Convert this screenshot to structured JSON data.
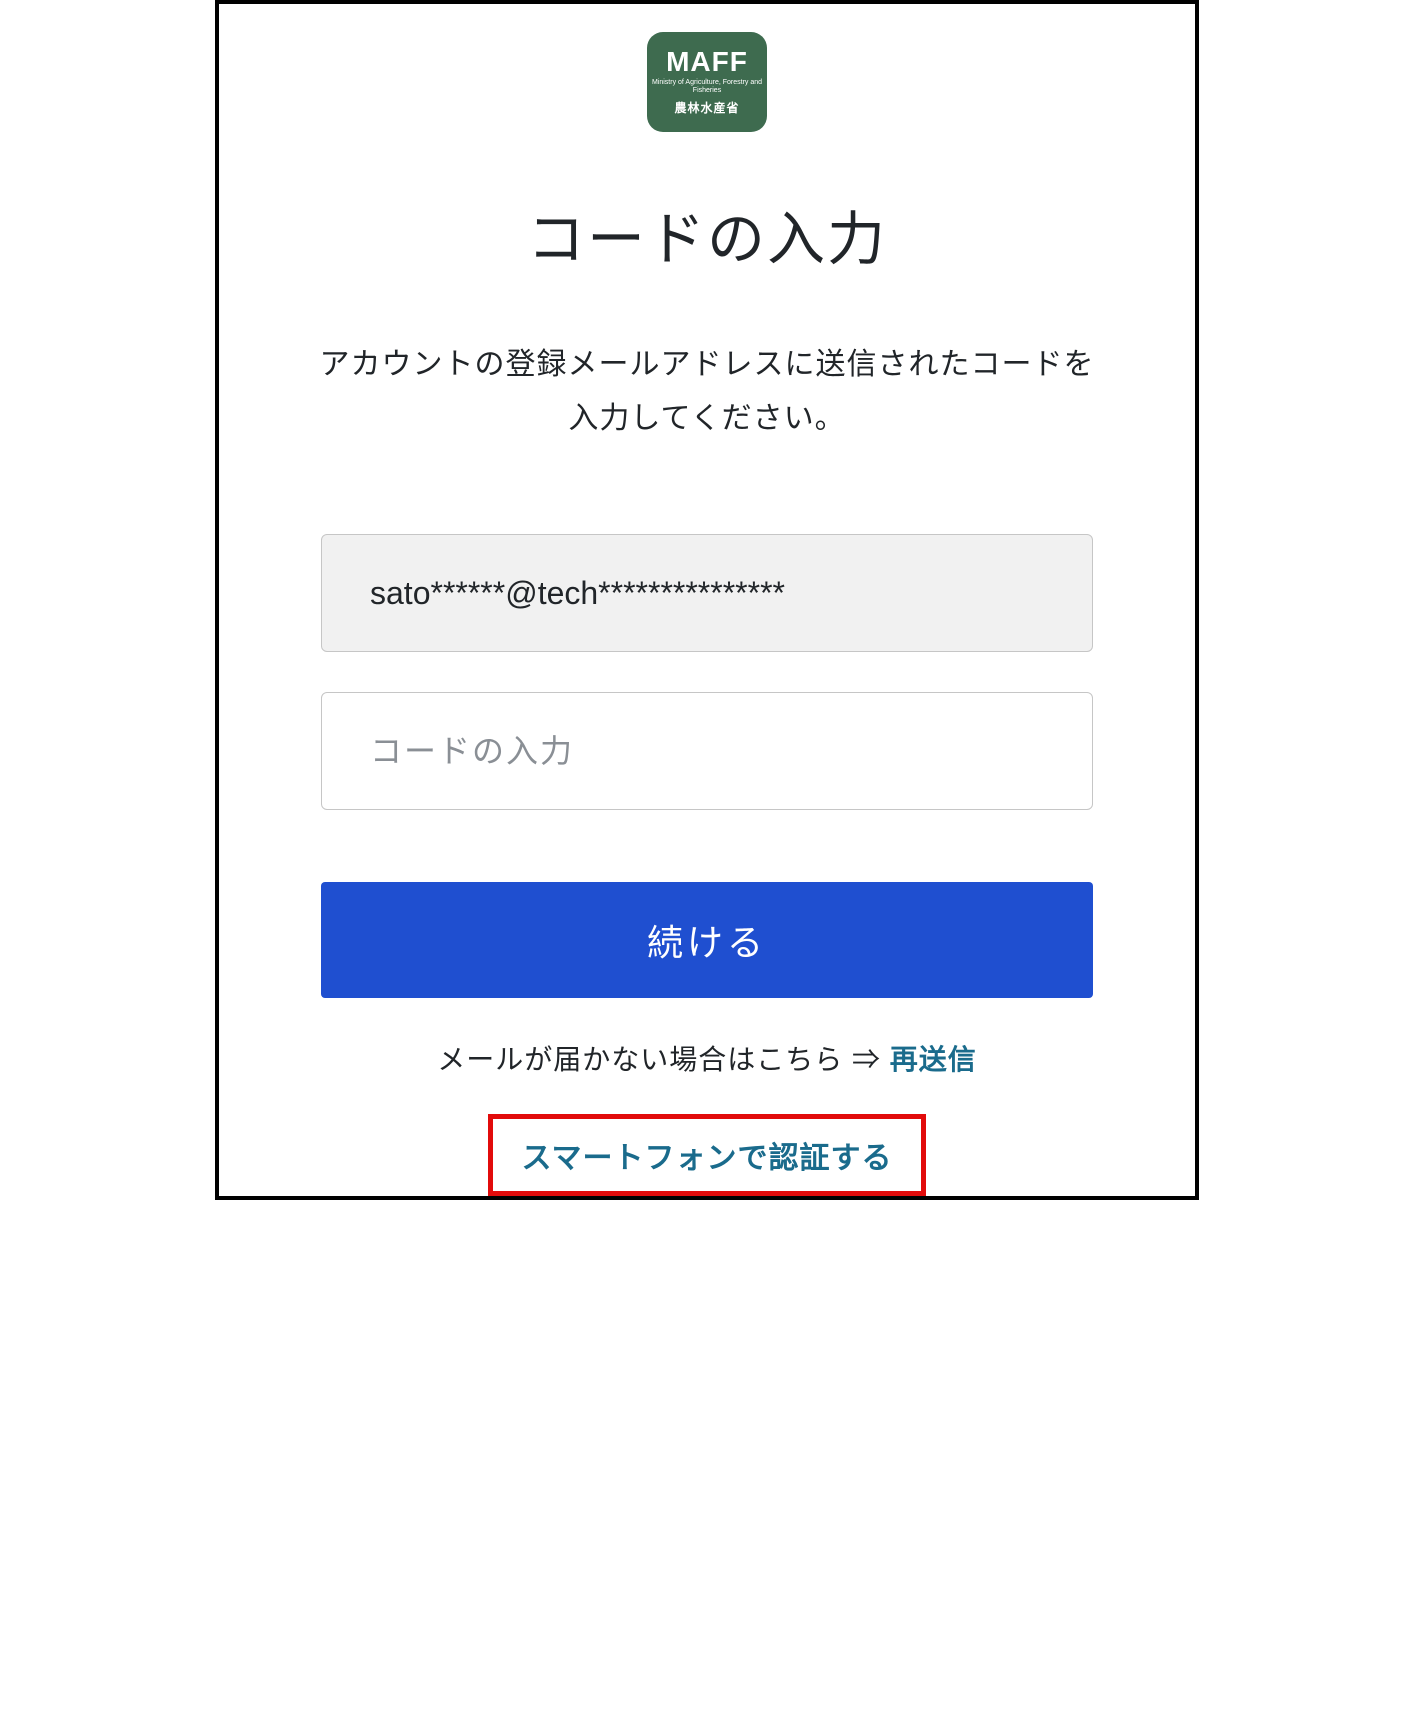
{
  "logo": {
    "main": "MAFF",
    "sub1": "Ministry of Agriculture,\nForestry and Fisheries",
    "sub2": "農林水産省"
  },
  "title": "コードの入力",
  "instruction": "アカウントの登録メールアドレスに送信されたコードを入力してください。",
  "email_masked": "sato******@tech***************",
  "code_placeholder": "コードの入力",
  "continue_label": "続ける",
  "resend_prefix": "メールが届かない場合はこちら ⇒ ",
  "resend_label": "再送信",
  "smartphone_label": "スマートフォンで認証する"
}
